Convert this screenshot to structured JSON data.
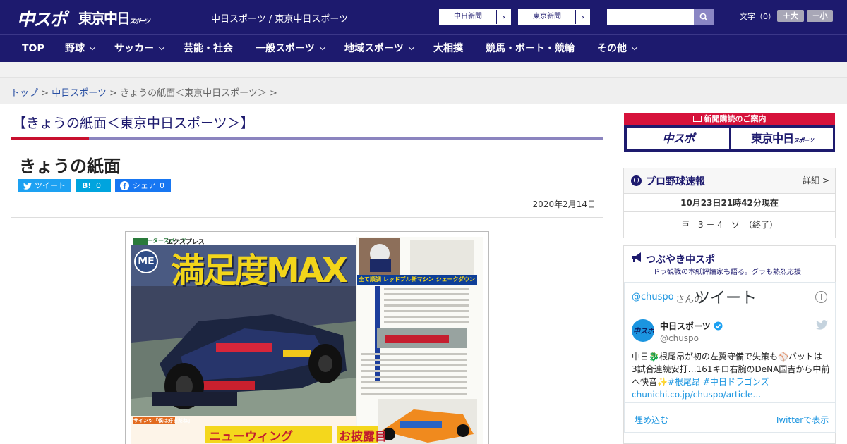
{
  "header": {
    "logo_main": "中スポ",
    "logo_tokyo": "東京中日",
    "logo_tokyo_small": "スポーツ",
    "site_link": "中日スポーツ / 東京中日スポーツ",
    "paper_buttons": [
      "中日新聞",
      "東京新聞"
    ],
    "search_placeholder": "",
    "font_label": "文字（0）",
    "font_plus": "＋大",
    "font_minus": "－小"
  },
  "nav": {
    "items": [
      {
        "label": "TOP",
        "has_menu": false
      },
      {
        "label": "野球",
        "has_menu": true
      },
      {
        "label": "サッカー",
        "has_menu": true
      },
      {
        "label": "芸能・社会",
        "has_menu": false
      },
      {
        "label": "一般スポーツ",
        "has_menu": true
      },
      {
        "label": "地域スポーツ",
        "has_menu": true
      },
      {
        "label": "大相撲",
        "has_menu": false
      },
      {
        "label": "競馬・ボート・競輪",
        "has_menu": false
      },
      {
        "label": "その他",
        "has_menu": true
      }
    ]
  },
  "breadcrumb": {
    "items": [
      "トップ",
      "中日スポーツ"
    ],
    "current": "きょうの紙面＜東京中日スポーツ＞",
    "separator": ">"
  },
  "page_title": "【きょうの紙面＜東京中日スポーツ＞】",
  "article": {
    "title": "きょうの紙面",
    "share": {
      "tweet": "ツイート",
      "hatena_label": "B!",
      "hatena_count": "0",
      "facebook_label": "シェア",
      "facebook_count": "0"
    },
    "date": "2020年2月14日",
    "paper": {
      "corner_label": "モータースポーツ",
      "series_label": "エクスプレス",
      "headline": "満足度MAX",
      "blue_caption": "全て順調 レッドブル新マシン シェークダウン",
      "small_box_label": "サインツ「僕は好きだね」",
      "bottom_headline_left": "ニューウィング",
      "bottom_headline_right": "お披露目"
    }
  },
  "sidebar": {
    "subscribe": {
      "title": "新聞購読のご案内",
      "buttons": [
        "中スポ",
        "東京中日"
      ],
      "button_small": "スポーツ"
    },
    "baseball": {
      "title": "プロ野球速報",
      "detail": "詳細 >",
      "timestamp": "10月23日21時42分現在",
      "score": "巨　3 － 4　ソ　（終了）"
    },
    "tweets": {
      "title": "つぶやき中スポ",
      "subtitle": "ドラ観戦の本紙評論家も語る。グラも熱烈応援",
      "handle_link": "@chuspo",
      "handle_suffix": "さんの",
      "header_word": "ツイート",
      "author_name": "中日スポーツ",
      "author_handle": "@chuspo",
      "avatar_text": "中スポ",
      "text_line1": "中日🐉根尾昂が初の左翼守備で失策も⚾バットは",
      "text_line2": "3試合連続安打…161キロ右腕のDeNA国吉から中前",
      "text_line3": "へ快音✨",
      "hashtags": "#根尾昂 #中日ドラゴンズ",
      "link": "chunichi.co.jp/chuspo/article…",
      "embed": "埋め込む",
      "view_on_twitter": "Twitterで表示"
    }
  },
  "colors": {
    "navy": "#1d1a6e",
    "red": "#d6123b",
    "twitter": "#1da1f2",
    "hatena": "#00a4de",
    "facebook": "#1877f2"
  }
}
